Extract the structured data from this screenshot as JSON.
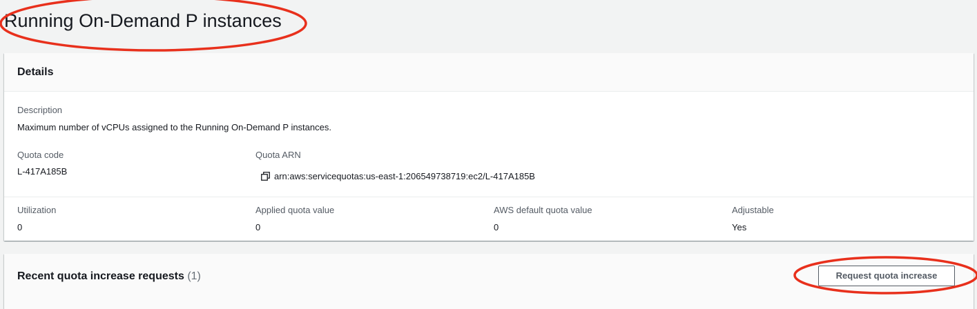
{
  "page": {
    "title": "Running On-Demand P instances"
  },
  "details": {
    "header": "Details",
    "description_label": "Description",
    "description_value": "Maximum number of vCPUs assigned to the Running On-Demand P instances.",
    "quota_code_label": "Quota code",
    "quota_code_value": "L-417A185B",
    "quota_arn_label": "Quota ARN",
    "quota_arn_value": "arn:aws:servicequotas:us-east-1:206549738719:ec2/L-417A185B",
    "copy_icon": "copy-icon",
    "utilization_label": "Utilization",
    "utilization_value": "0",
    "applied_label": "Applied quota value",
    "applied_value": "0",
    "default_label": "AWS default quota value",
    "default_value": "0",
    "adjustable_label": "Adjustable",
    "adjustable_value": "Yes"
  },
  "requests": {
    "title": "Recent quota increase requests",
    "count": "(1)",
    "button_label": "Request quota increase"
  },
  "annotation": {
    "color": "#e8301c"
  }
}
